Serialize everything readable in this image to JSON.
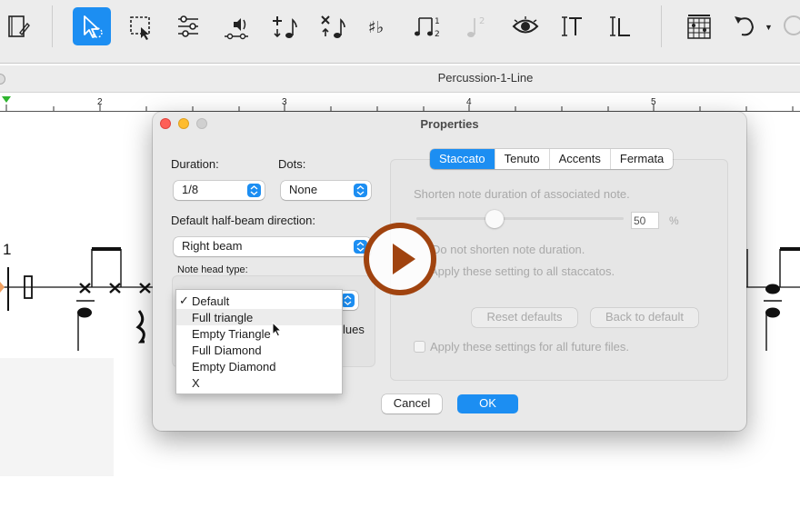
{
  "toolbar": {
    "buttons": [
      {
        "icon": "document-edit-icon",
        "active": false
      },
      {
        "icon": "selection-arrow-icon",
        "active": true
      },
      {
        "icon": "box-select-icon",
        "active": false
      },
      {
        "icon": "sliders-icon",
        "active": false
      },
      {
        "icon": "speaker-playback-icon",
        "active": false
      },
      {
        "icon": "add-note-icon",
        "active": false
      },
      {
        "icon": "delete-note-icon",
        "active": false
      },
      {
        "icon": "accidentals-icon",
        "active": false
      },
      {
        "icon": "tuplet-icon",
        "active": false
      },
      {
        "icon": "voice-2-icon",
        "active": false
      },
      {
        "icon": "eye-icon",
        "active": false
      },
      {
        "icon": "text-cursor-icon",
        "active": false
      },
      {
        "icon": "lyrics-cursor-icon",
        "active": false
      },
      {
        "icon": "chord-grid-icon",
        "active": false
      },
      {
        "icon": "undo-icon",
        "active": false
      }
    ],
    "tuplet_number": "1\n2",
    "voice_number": "2"
  },
  "document": {
    "title": "Percussion-1-Line"
  },
  "ruler": {
    "marks": [
      "2",
      "3",
      "4",
      "5"
    ]
  },
  "score": {
    "measure_number": "1"
  },
  "dialog": {
    "title": "Properties",
    "duration_label": "Duration:",
    "duration_value": "1/8",
    "dots_label": "Dots:",
    "dots_value": "None",
    "half_beam_label": "Default half-beam direction:",
    "half_beam_value": "Right beam",
    "notehead_label": "Note head type:",
    "notehead_menu": {
      "items": [
        {
          "label": "Default",
          "checked": true,
          "highlighted": false
        },
        {
          "label": "Full triangle",
          "checked": false,
          "highlighted": true
        },
        {
          "label": "Empty Triangle",
          "checked": false,
          "highlighted": false
        },
        {
          "label": "Full Diamond",
          "checked": false,
          "highlighted": false
        },
        {
          "label": "Empty Diamond",
          "checked": false,
          "highlighted": false
        },
        {
          "label": "X",
          "checked": false,
          "highlighted": false
        }
      ]
    },
    "obscured_text": "lues",
    "tabs": [
      {
        "label": "Staccato",
        "selected": true
      },
      {
        "label": "Tenuto",
        "selected": false
      },
      {
        "label": "Accents",
        "selected": false
      },
      {
        "label": "Fermata",
        "selected": false
      }
    ],
    "staccato": {
      "shorten_label": "Shorten note duration of associated note.",
      "slider_value": "50",
      "unit": "%",
      "no_shorten_label": "Do not shorten note duration.",
      "apply_all_label": "Apply these setting to all staccatos.",
      "reset_defaults": "Reset defaults",
      "back_to_default": "Back to default",
      "future_files_label": "Apply these settings for all future files."
    },
    "cancel": "Cancel",
    "ok": "OK"
  },
  "colors": {
    "accent": "#1c8ef2",
    "play_button": "#a0430f"
  }
}
